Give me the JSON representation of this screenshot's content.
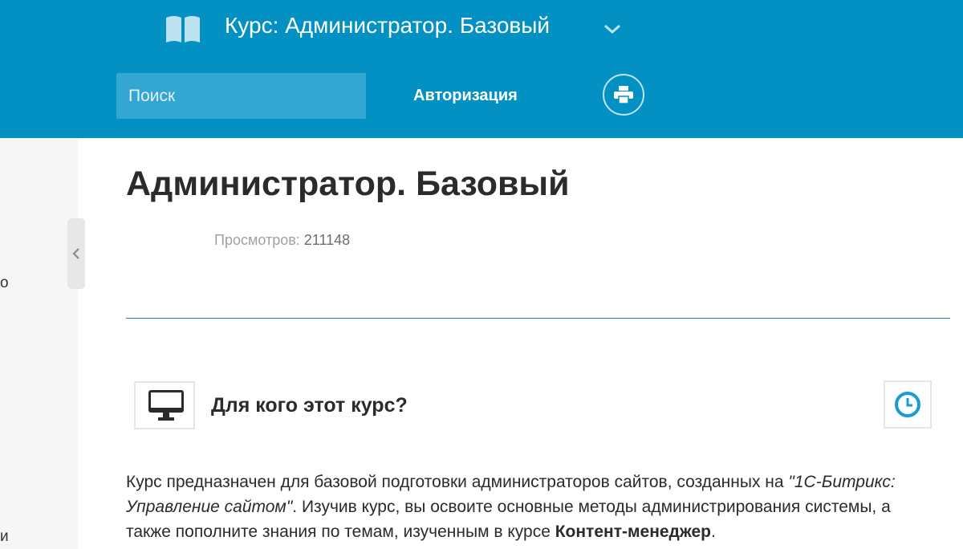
{
  "header": {
    "course_title": "Курс: Администратор. Базовый",
    "search_placeholder": "Поиск",
    "auth_label": "Авторизация",
    "icons": {
      "book": "book-icon",
      "chevron": "chevron-down-icon",
      "print": "printer-icon"
    }
  },
  "sidebar": {
    "fragment_1": "о",
    "fragment_2": "и",
    "collapse_icon": "chevron-left-icon"
  },
  "main": {
    "title": "Администратор. Базовый",
    "views_label": "Просмотров:",
    "views_count": "211148",
    "section": {
      "icon": "monitor-icon",
      "heading": "Для кого этот курс?",
      "clock_icon": "clock-icon"
    },
    "description": {
      "part1": "Курс предназначен для базовой подготовки администраторов сайтов, созданных на ",
      "product": "\"1С-Битрикс: Управление сайтом\"",
      "part2": ". Изучив курс, вы освоите основные методы администрирования системы, а также пополните знания по темам, изученным в курсе ",
      "course_link": "Контент-менеджер",
      "part3": "."
    }
  },
  "colors": {
    "header_bg": "#0291c2",
    "search_bg": "#33a7d2",
    "accent": "#0a84b4",
    "clock": "#1a9bd3"
  }
}
